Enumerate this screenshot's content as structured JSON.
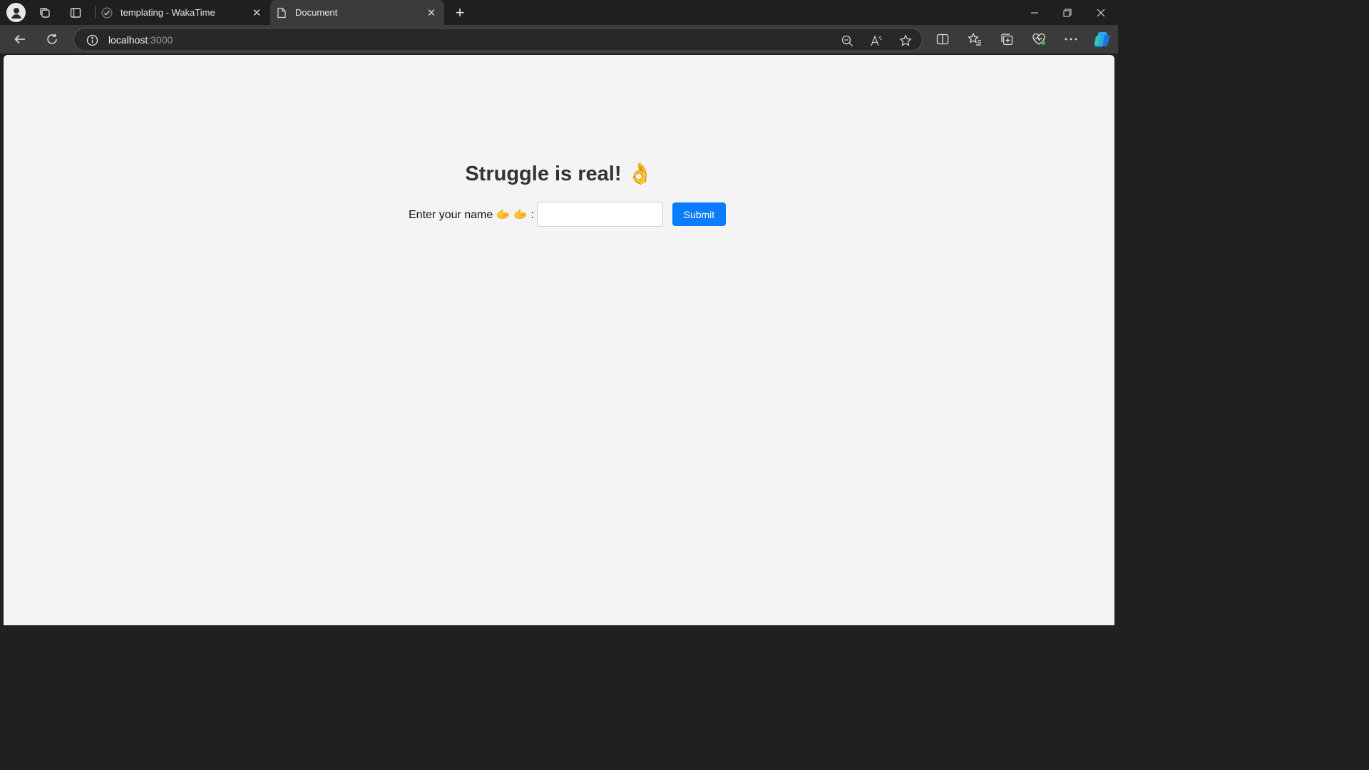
{
  "browser": {
    "tabs": [
      {
        "title": "templating - WakaTime",
        "active": false
      },
      {
        "title": "Document",
        "active": true
      }
    ],
    "url": {
      "host": "localhost",
      "port": ":3000"
    }
  },
  "page": {
    "heading": "Struggle is real! 👌",
    "label": "Enter your name 🫱 🫱 :",
    "input_value": "",
    "submit_label": "Submit"
  },
  "colors": {
    "accent": "#0a7cff",
    "page_background": "#f4f4f4",
    "chrome_dark": "#1f1f1f"
  }
}
